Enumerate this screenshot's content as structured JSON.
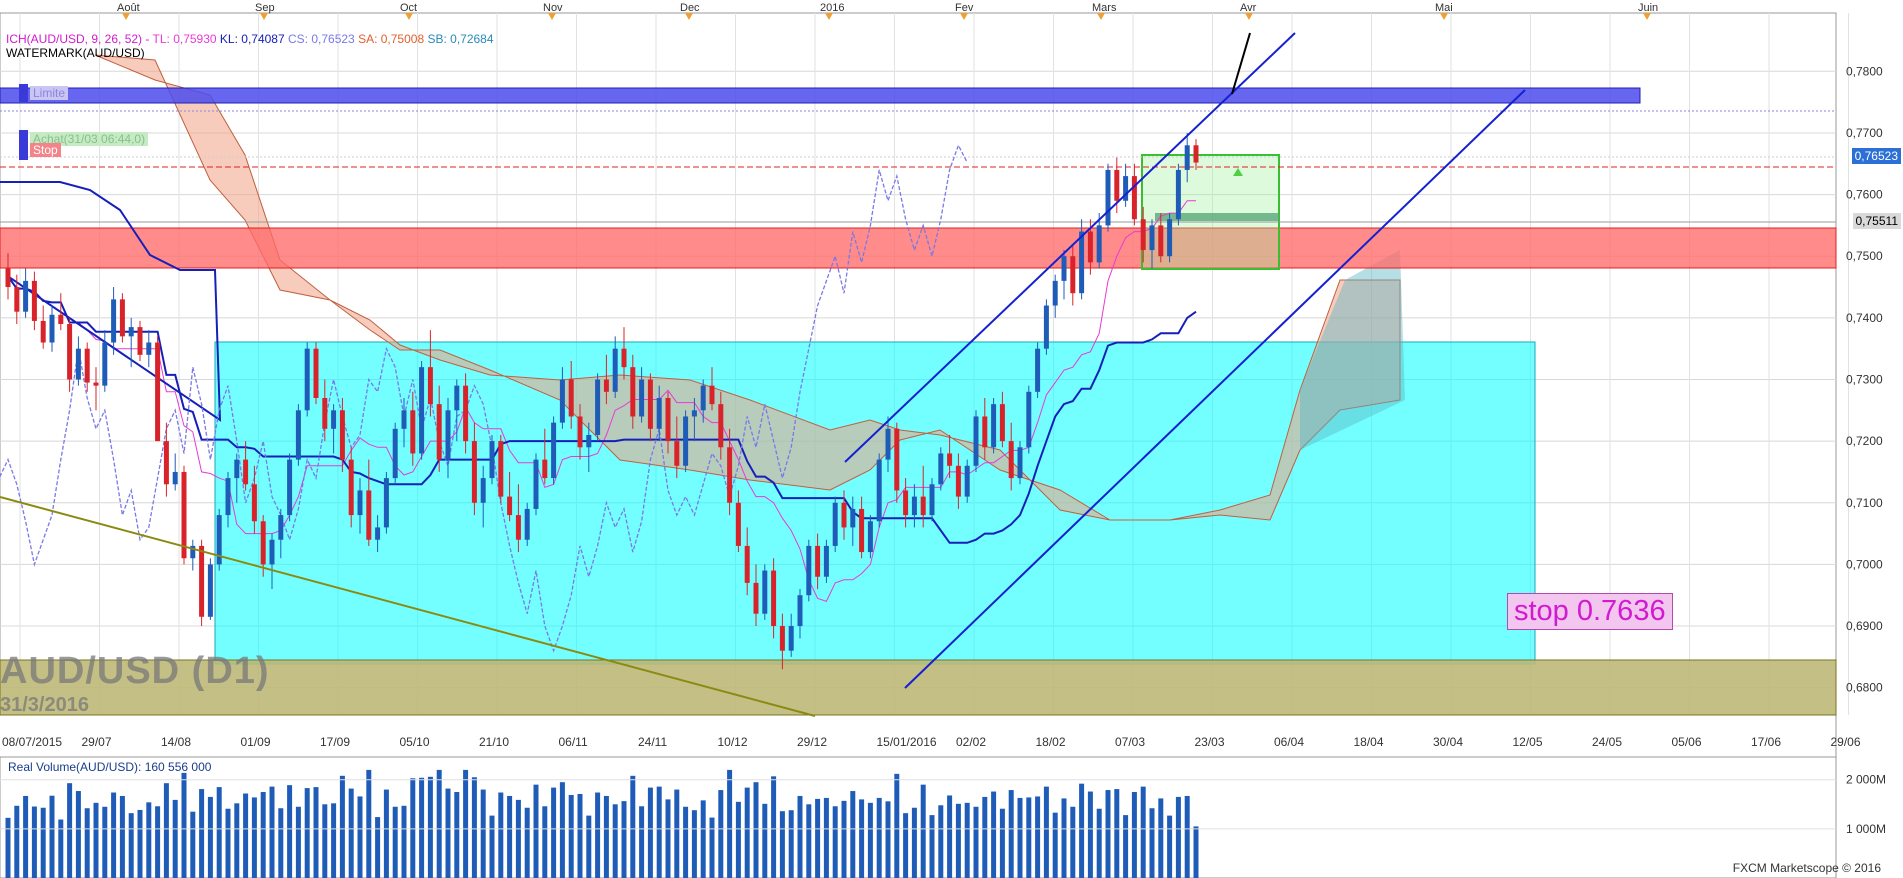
{
  "chart_data": {
    "type": "candlestick",
    "title": "AUD/USD (D1)",
    "date_label": "31/3/2016",
    "indicator_header": {
      "ich": "ICH(AUD/USD, 9, 26, 52)",
      "tl": "TL: 0,75930",
      "kl": "KL: 0,74087",
      "cs": "CS: 0,76523",
      "sa": "SA: 0,75008",
      "sb": "SB: 0,72684",
      "watermark": "WATERMARK(AUD/USD)"
    },
    "months": [
      "Août",
      "Sep",
      "Oct",
      "Nov",
      "Dec",
      "2016",
      "Fev",
      "Mars",
      "Avr",
      "Mai",
      "Juin"
    ],
    "x_ticks": [
      "08/07/2015",
      "29/07",
      "14/08",
      "01/09",
      "17/09",
      "05/10",
      "21/10",
      "06/11",
      "24/11",
      "10/12",
      "29/12",
      "15/01/2016",
      "02/02",
      "18/02",
      "07/03",
      "23/03",
      "06/04",
      "18/04",
      "30/04",
      "12/05",
      "24/05",
      "05/06",
      "17/06",
      "29/06"
    ],
    "y_ticks": [
      "0,7800",
      "0,7700",
      "0,7600",
      "0,7500",
      "0,7400",
      "0,7300",
      "0,7200",
      "0,7100",
      "0,7000",
      "0,6900",
      "0,6800"
    ],
    "ylim": [
      0.678,
      0.788
    ],
    "price_tags": {
      "current": "0,76523",
      "level": "0,75511"
    },
    "zones": {
      "limit_label": "Limite",
      "buy_label": "Achat(31/03 06:44,0)",
      "stop_label": "Stop"
    },
    "annotation": "stop 0.7636",
    "ohlc": [
      [
        0.748,
        0.7505,
        0.743,
        0.745
      ],
      [
        0.745,
        0.747,
        0.739,
        0.741
      ],
      [
        0.741,
        0.748,
        0.74,
        0.746
      ],
      [
        0.746,
        0.7475,
        0.738,
        0.7395
      ],
      [
        0.7395,
        0.742,
        0.735,
        0.736
      ],
      [
        0.736,
        0.742,
        0.7345,
        0.7405
      ],
      [
        0.7405,
        0.744,
        0.738,
        0.739
      ],
      [
        0.739,
        0.74,
        0.728,
        0.73
      ],
      [
        0.73,
        0.737,
        0.729,
        0.735
      ],
      [
        0.735,
        0.736,
        0.728,
        0.7295
      ],
      [
        0.7295,
        0.732,
        0.725,
        0.729
      ],
      [
        0.729,
        0.738,
        0.728,
        0.736
      ],
      [
        0.736,
        0.745,
        0.734,
        0.743
      ],
      [
        0.743,
        0.744,
        0.736,
        0.737
      ],
      [
        0.737,
        0.74,
        0.732,
        0.7385
      ],
      [
        0.7385,
        0.7395,
        0.733,
        0.734
      ],
      [
        0.734,
        0.738,
        0.732,
        0.736
      ],
      [
        0.736,
        0.737,
        0.728,
        0.72
      ],
      [
        0.72,
        0.723,
        0.711,
        0.713
      ],
      [
        0.713,
        0.718,
        0.712,
        0.715
      ],
      [
        0.715,
        0.716,
        0.7,
        0.701
      ],
      [
        0.701,
        0.704,
        0.699,
        0.703
      ],
      [
        0.703,
        0.704,
        0.69,
        0.6915
      ],
      [
        0.6915,
        0.701,
        0.691,
        0.7
      ],
      [
        0.7,
        0.709,
        0.699,
        0.708
      ],
      [
        0.708,
        0.715,
        0.706,
        0.714
      ],
      [
        0.714,
        0.718,
        0.71,
        0.717
      ],
      [
        0.717,
        0.72,
        0.712,
        0.713
      ],
      [
        0.713,
        0.716,
        0.705,
        0.707
      ],
      [
        0.707,
        0.708,
        0.698,
        0.7
      ],
      [
        0.7,
        0.705,
        0.696,
        0.704
      ],
      [
        0.704,
        0.709,
        0.701,
        0.708
      ],
      [
        0.708,
        0.718,
        0.707,
        0.717
      ],
      [
        0.717,
        0.726,
        0.716,
        0.725
      ],
      [
        0.725,
        0.736,
        0.724,
        0.735
      ],
      [
        0.735,
        0.736,
        0.726,
        0.727
      ],
      [
        0.727,
        0.73,
        0.72,
        0.722
      ],
      [
        0.722,
        0.726,
        0.718,
        0.725
      ],
      [
        0.725,
        0.727,
        0.715,
        0.717
      ],
      [
        0.717,
        0.719,
        0.706,
        0.708
      ],
      [
        0.708,
        0.714,
        0.705,
        0.712
      ],
      [
        0.712,
        0.717,
        0.703,
        0.704
      ],
      [
        0.704,
        0.708,
        0.702,
        0.706
      ],
      [
        0.706,
        0.715,
        0.705,
        0.714
      ],
      [
        0.714,
        0.723,
        0.713,
        0.722
      ],
      [
        0.722,
        0.727,
        0.719,
        0.725
      ],
      [
        0.725,
        0.728,
        0.716,
        0.718
      ],
      [
        0.718,
        0.733,
        0.717,
        0.732
      ],
      [
        0.732,
        0.738,
        0.724,
        0.726
      ],
      [
        0.726,
        0.729,
        0.715,
        0.717
      ],
      [
        0.717,
        0.727,
        0.714,
        0.725
      ],
      [
        0.725,
        0.73,
        0.72,
        0.729
      ],
      [
        0.729,
        0.731,
        0.718,
        0.72
      ],
      [
        0.72,
        0.723,
        0.708,
        0.71
      ],
      [
        0.71,
        0.716,
        0.706,
        0.714
      ],
      [
        0.714,
        0.721,
        0.713,
        0.72
      ],
      [
        0.72,
        0.721,
        0.71,
        0.711
      ],
      [
        0.711,
        0.715,
        0.707,
        0.708
      ],
      [
        0.708,
        0.713,
        0.702,
        0.704
      ],
      [
        0.704,
        0.71,
        0.703,
        0.709
      ],
      [
        0.709,
        0.718,
        0.708,
        0.717
      ],
      [
        0.717,
        0.722,
        0.713,
        0.714
      ],
      [
        0.714,
        0.724,
        0.713,
        0.723
      ],
      [
        0.723,
        0.732,
        0.722,
        0.73
      ],
      [
        0.73,
        0.733,
        0.722,
        0.724
      ],
      [
        0.724,
        0.726,
        0.717,
        0.719
      ],
      [
        0.719,
        0.723,
        0.715,
        0.721
      ],
      [
        0.721,
        0.731,
        0.72,
        0.73
      ],
      [
        0.73,
        0.734,
        0.726,
        0.728
      ],
      [
        0.728,
        0.737,
        0.727,
        0.735
      ],
      [
        0.735,
        0.7385,
        0.73,
        0.732
      ],
      [
        0.732,
        0.734,
        0.722,
        0.724
      ],
      [
        0.724,
        0.732,
        0.723,
        0.73
      ],
      [
        0.73,
        0.731,
        0.72,
        0.722
      ],
      [
        0.722,
        0.729,
        0.72,
        0.727
      ],
      [
        0.727,
        0.728,
        0.718,
        0.72
      ],
      [
        0.72,
        0.724,
        0.714,
        0.716
      ],
      [
        0.716,
        0.725,
        0.715,
        0.724
      ],
      [
        0.724,
        0.727,
        0.72,
        0.725
      ],
      [
        0.725,
        0.73,
        0.723,
        0.729
      ],
      [
        0.729,
        0.732,
        0.725,
        0.726
      ],
      [
        0.726,
        0.728,
        0.717,
        0.719
      ],
      [
        0.719,
        0.722,
        0.708,
        0.71
      ],
      [
        0.71,
        0.712,
        0.702,
        0.703
      ],
      [
        0.703,
        0.706,
        0.695,
        0.697
      ],
      [
        0.697,
        0.7,
        0.69,
        0.692
      ],
      [
        0.692,
        0.7,
        0.691,
        0.699
      ],
      [
        0.699,
        0.701,
        0.688,
        0.69
      ],
      [
        0.69,
        0.692,
        0.683,
        0.686
      ],
      [
        0.686,
        0.692,
        0.685,
        0.69
      ],
      [
        0.69,
        0.696,
        0.688,
        0.695
      ],
      [
        0.695,
        0.704,
        0.694,
        0.703
      ],
      [
        0.703,
        0.705,
        0.696,
        0.698
      ],
      [
        0.698,
        0.704,
        0.697,
        0.703
      ],
      [
        0.703,
        0.711,
        0.702,
        0.71
      ],
      [
        0.71,
        0.712,
        0.704,
        0.706
      ],
      [
        0.706,
        0.711,
        0.703,
        0.709
      ],
      [
        0.709,
        0.711,
        0.701,
        0.702
      ],
      [
        0.702,
        0.708,
        0.701,
        0.707
      ],
      [
        0.707,
        0.718,
        0.706,
        0.717
      ],
      [
        0.717,
        0.724,
        0.715,
        0.722
      ],
      [
        0.722,
        0.723,
        0.71,
        0.712
      ],
      [
        0.712,
        0.714,
        0.706,
        0.708
      ],
      [
        0.708,
        0.713,
        0.706,
        0.711
      ],
      [
        0.711,
        0.716,
        0.706,
        0.708
      ],
      [
        0.708,
        0.714,
        0.707,
        0.713
      ],
      [
        0.713,
        0.719,
        0.712,
        0.718
      ],
      [
        0.718,
        0.721,
        0.714,
        0.716
      ],
      [
        0.716,
        0.718,
        0.709,
        0.711
      ],
      [
        0.711,
        0.717,
        0.71,
        0.716
      ],
      [
        0.716,
        0.725,
        0.715,
        0.724
      ],
      [
        0.724,
        0.727,
        0.717,
        0.719
      ],
      [
        0.719,
        0.727,
        0.718,
        0.726
      ],
      [
        0.726,
        0.728,
        0.719,
        0.72
      ],
      [
        0.72,
        0.723,
        0.712,
        0.714
      ],
      [
        0.714,
        0.72,
        0.713,
        0.719
      ],
      [
        0.719,
        0.729,
        0.718,
        0.728
      ],
      [
        0.728,
        0.736,
        0.727,
        0.735
      ],
      [
        0.735,
        0.743,
        0.734,
        0.742
      ],
      [
        0.742,
        0.747,
        0.74,
        0.746
      ],
      [
        0.746,
        0.751,
        0.743,
        0.75
      ],
      [
        0.75,
        0.752,
        0.742,
        0.744
      ],
      [
        0.744,
        0.756,
        0.743,
        0.754
      ],
      [
        0.754,
        0.756,
        0.747,
        0.749
      ],
      [
        0.749,
        0.757,
        0.748,
        0.755
      ],
      [
        0.755,
        0.765,
        0.754,
        0.764
      ],
      [
        0.764,
        0.766,
        0.757,
        0.759
      ],
      [
        0.759,
        0.765,
        0.758,
        0.763
      ],
      [
        0.763,
        0.765,
        0.755,
        0.756
      ],
      [
        0.756,
        0.758,
        0.749,
        0.751
      ],
      [
        0.751,
        0.756,
        0.748,
        0.755
      ],
      [
        0.755,
        0.757,
        0.749,
        0.75
      ],
      [
        0.75,
        0.757,
        0.749,
        0.756
      ],
      [
        0.756,
        0.765,
        0.755,
        0.764
      ],
      [
        0.764,
        0.77,
        0.762,
        0.768
      ],
      [
        0.768,
        0.769,
        0.764,
        0.7652
      ]
    ],
    "volume": {
      "y_ticks": [
        "2 000M",
        "1 000M"
      ],
      "header": "Real Volume(AUD/USD): 160 556 000"
    }
  },
  "footer": "FXCM Marketscope © 2016",
  "colors": {
    "bull": "#1f5cb8",
    "bear": "#d9232a",
    "tenkan": "#e83ad6",
    "kijun": "#1520b8",
    "chikou": "#7a78e8",
    "cloudBull": "#5bb6c6",
    "cloudBear": "#f0a385",
    "cyanBox": "#00ffff",
    "redZone": "#ff6a6a",
    "limitBar": "#4b4bee",
    "oliveBox": "#bdb878"
  }
}
